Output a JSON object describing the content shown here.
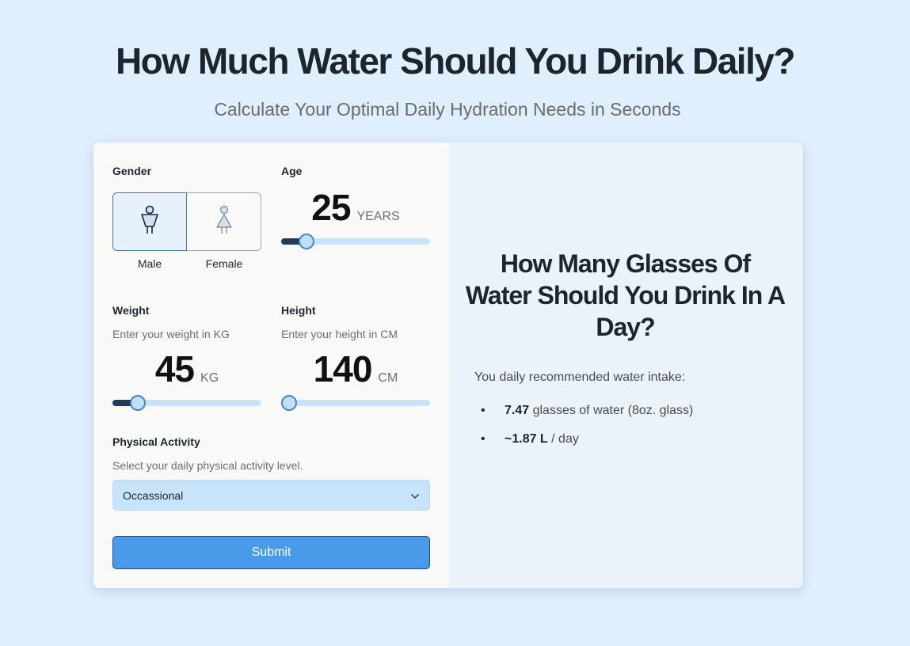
{
  "header": {
    "title": "How Much Water Should You Drink Daily?",
    "subtitle": "Calculate Your Optimal Daily Hydration Needs in Seconds"
  },
  "form": {
    "gender": {
      "label": "Gender",
      "options": [
        "Male",
        "Female"
      ],
      "selected": "Male"
    },
    "age": {
      "label": "Age",
      "value": "25",
      "unit": "YEARS",
      "slider_fraction": 0.13
    },
    "weight": {
      "label": "Weight",
      "hint": "Enter your weight in KG",
      "value": "45",
      "unit": "KG",
      "slider_fraction": 0.13
    },
    "height": {
      "label": "Height",
      "hint": "Enter your height in CM",
      "value": "140",
      "unit": "CM",
      "slider_fraction": 0.0
    },
    "activity": {
      "label": "Physical Activity",
      "hint": "Select your daily physical activity level.",
      "selected": "Occassional"
    },
    "submit_label": "Submit"
  },
  "result": {
    "title": "How Many Glasses Of Water Should You Drink In A Day?",
    "intro": "You daily recommended water intake:",
    "items": [
      {
        "value": "7.47",
        "text": " glasses of water (8oz. glass)"
      },
      {
        "value": "~1.87 L",
        "text": " / day"
      }
    ]
  },
  "colors": {
    "background": "#dfeffd",
    "accent": "#4a9aea",
    "slider_fill": "#213c58",
    "slider_track": "#c8e3fb"
  },
  "icons": [
    "male-icon",
    "female-icon",
    "chevron-down-icon"
  ]
}
